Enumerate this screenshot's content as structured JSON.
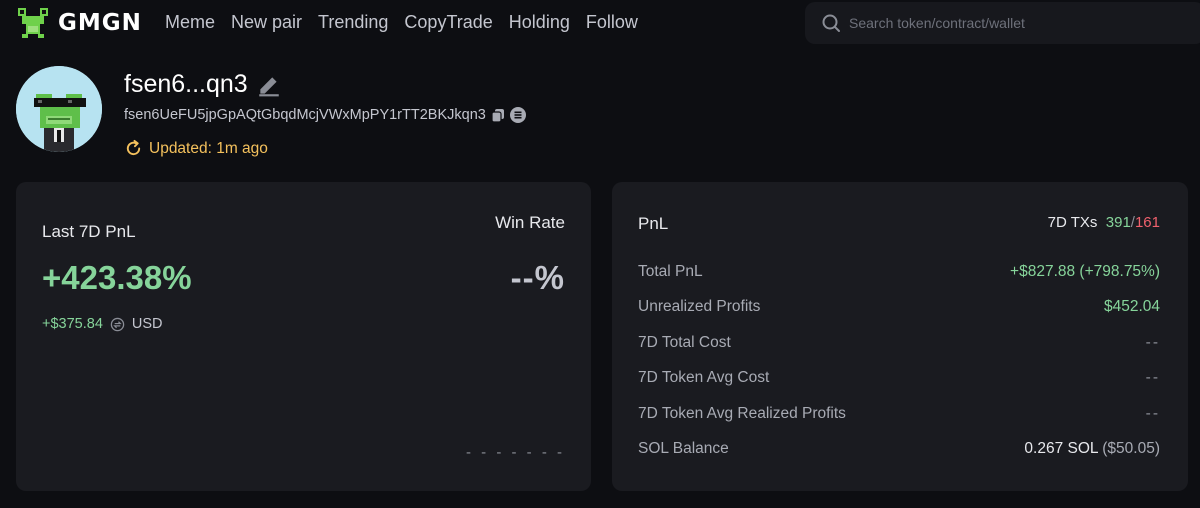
{
  "nav": {
    "logo_text": "GMGN",
    "links": [
      "Meme",
      "New pair",
      "Trending",
      "CopyTrade",
      "Holding",
      "Follow"
    ],
    "search_placeholder": "Search token/contract/wallet"
  },
  "profile": {
    "name": "fsen6...qn3",
    "address": "fsen6UeFU5jpGpAQtGbqdMcjVWxMpPY1rTT2BKJkqn3",
    "updated": "Updated: 1m ago"
  },
  "left_card": {
    "pnl_label": "Last 7D PnL",
    "win_label": "Win Rate",
    "pnl_percent": "+423.38%",
    "win_rate": "--%",
    "pnl_usd": "+$375.84",
    "currency": "USD",
    "bar_placeholder": "- - - - - - -"
  },
  "right_card": {
    "title": "PnL",
    "txs_label": "7D TXs",
    "txs_buy": "391",
    "txs_sep": "/",
    "txs_sell": "161",
    "rows": [
      {
        "label": "Total PnL",
        "value": "+$827.88 (+798.75%)"
      },
      {
        "label": "Unrealized Profits",
        "value": "$452.04"
      },
      {
        "label": "7D Total Cost",
        "value": "--"
      },
      {
        "label": "7D Token Avg Cost",
        "value": "--"
      },
      {
        "label": "7D Token Avg Realized Profits",
        "value": "--"
      },
      {
        "label": "SOL Balance",
        "value": "0.267 SOL",
        "sub": "($50.05)"
      }
    ]
  },
  "colors": {
    "accent_green": "#86d49a",
    "accent_red": "#f0616d",
    "accent_yellow": "#f4c15d",
    "card_bg": "#1a1b20",
    "page_bg": "#0d0e12"
  },
  "icons": [
    "frog-logo-icon",
    "search-icon",
    "edit-pencil-icon",
    "copy-icon",
    "solana-icon",
    "refresh-icon",
    "currency-swap-icon"
  ]
}
